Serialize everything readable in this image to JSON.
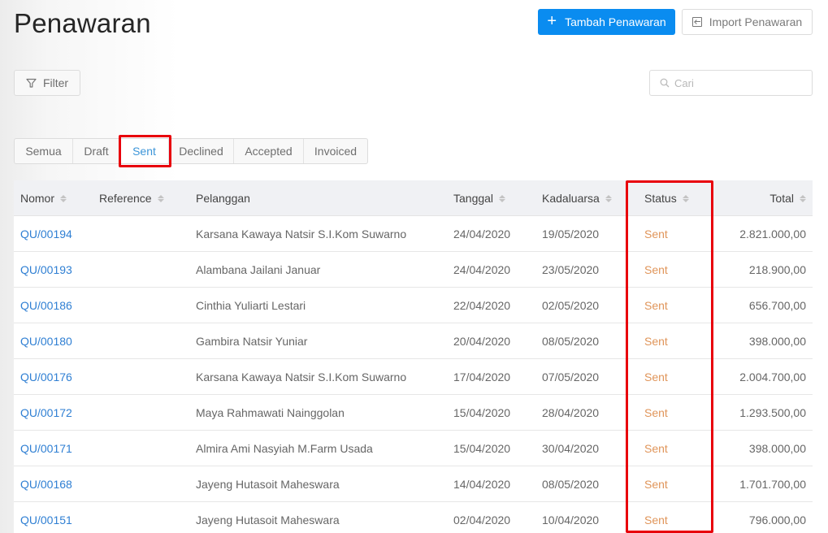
{
  "header": {
    "title": "Penawaran",
    "add_button_label": "Tambah Penawaran",
    "import_button_label": "Import Penawaran"
  },
  "toolbar": {
    "filter_label": "Filter",
    "search_placeholder": "Cari",
    "search_value": ""
  },
  "tabs": [
    {
      "label": "Semua",
      "active": false
    },
    {
      "label": "Draft",
      "active": false
    },
    {
      "label": "Sent",
      "active": true
    },
    {
      "label": "Declined",
      "active": false
    },
    {
      "label": "Accepted",
      "active": false
    },
    {
      "label": "Invoiced",
      "active": false
    }
  ],
  "table": {
    "columns": {
      "nomor": "Nomor",
      "reference": "Reference",
      "pelanggan": "Pelanggan",
      "tanggal": "Tanggal",
      "kadaluarsa": "Kadaluarsa",
      "status": "Status",
      "total": "Total"
    },
    "rows": [
      {
        "nomor": "QU/00194",
        "reference": "",
        "pelanggan": "Karsana Kawaya Natsir S.I.Kom Suwarno",
        "tanggal": "24/04/2020",
        "kadaluarsa": "19/05/2020",
        "status": "Sent",
        "total": "2.821.000,00"
      },
      {
        "nomor": "QU/00193",
        "reference": "",
        "pelanggan": "Alambana Jailani Januar",
        "tanggal": "24/04/2020",
        "kadaluarsa": "23/05/2020",
        "status": "Sent",
        "total": "218.900,00"
      },
      {
        "nomor": "QU/00186",
        "reference": "",
        "pelanggan": "Cinthia Yuliarti Lestari",
        "tanggal": "22/04/2020",
        "kadaluarsa": "02/05/2020",
        "status": "Sent",
        "total": "656.700,00"
      },
      {
        "nomor": "QU/00180",
        "reference": "",
        "pelanggan": "Gambira Natsir Yuniar",
        "tanggal": "20/04/2020",
        "kadaluarsa": "08/05/2020",
        "status": "Sent",
        "total": "398.000,00"
      },
      {
        "nomor": "QU/00176",
        "reference": "",
        "pelanggan": "Karsana Kawaya Natsir S.I.Kom Suwarno",
        "tanggal": "17/04/2020",
        "kadaluarsa": "07/05/2020",
        "status": "Sent",
        "total": "2.004.700,00"
      },
      {
        "nomor": "QU/00172",
        "reference": "",
        "pelanggan": "Maya Rahmawati Nainggolan",
        "tanggal": "15/04/2020",
        "kadaluarsa": "28/04/2020",
        "status": "Sent",
        "total": "1.293.500,00"
      },
      {
        "nomor": "QU/00171",
        "reference": "",
        "pelanggan": "Almira Ami Nasyiah M.Farm Usada",
        "tanggal": "15/04/2020",
        "kadaluarsa": "30/04/2020",
        "status": "Sent",
        "total": "398.000,00"
      },
      {
        "nomor": "QU/00168",
        "reference": "",
        "pelanggan": "Jayeng Hutasoit Maheswara",
        "tanggal": "14/04/2020",
        "kadaluarsa": "08/05/2020",
        "status": "Sent",
        "total": "1.701.700,00"
      },
      {
        "nomor": "QU/00151",
        "reference": "",
        "pelanggan": "Jayeng Hutasoit Maheswara",
        "tanggal": "02/04/2020",
        "kadaluarsa": "10/04/2020",
        "status": "Sent",
        "total": "796.000,00"
      }
    ]
  },
  "colors": {
    "primary": "#0a8cf0",
    "link": "#2f7fd3",
    "active_tab": "#3c95d8",
    "status_sent": "#e0955a",
    "annotation_red": "#e8000b"
  }
}
